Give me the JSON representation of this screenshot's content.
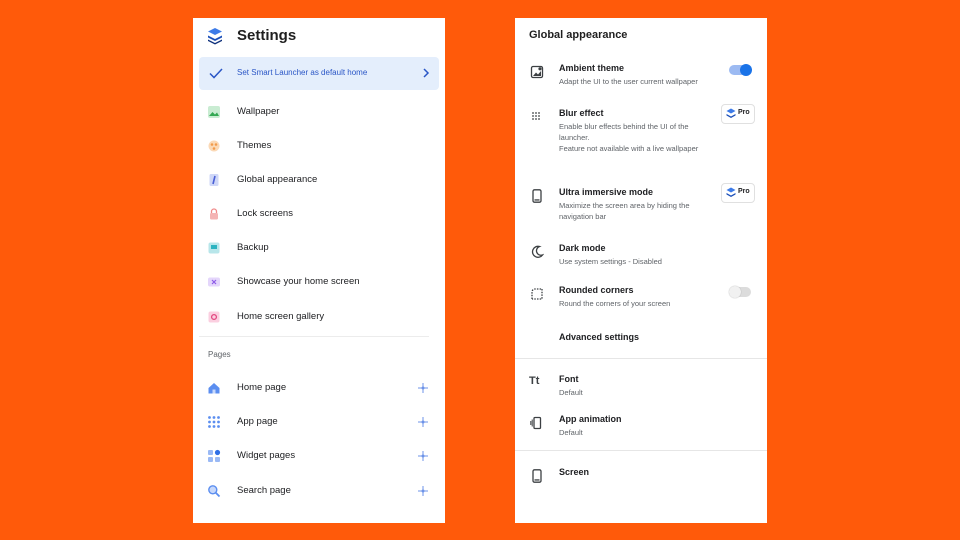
{
  "left": {
    "title": "Settings",
    "banner": "Set Smart Launcher as default home",
    "items": [
      {
        "label": "Wallpaper",
        "icon": "wallpaper-icon"
      },
      {
        "label": "Themes",
        "icon": "themes-icon"
      },
      {
        "label": "Global appearance",
        "icon": "global-appearance-icon"
      },
      {
        "label": "Lock screens",
        "icon": "lock-icon"
      },
      {
        "label": "Backup",
        "icon": "backup-icon"
      },
      {
        "label": "Showcase your home screen",
        "icon": "showcase-icon"
      },
      {
        "label": "Home screen gallery",
        "icon": "gallery-icon"
      }
    ],
    "pages_label": "Pages",
    "pages": [
      {
        "label": "Home page",
        "icon": "home-icon"
      },
      {
        "label": "App page",
        "icon": "app-grid-icon"
      },
      {
        "label": "Widget pages",
        "icon": "widget-icon"
      },
      {
        "label": "Search page",
        "icon": "search-icon"
      }
    ]
  },
  "right": {
    "title": "Global appearance",
    "settings": [
      {
        "title": "Ambient theme",
        "desc": "Adapt the UI to the user current wallpaper",
        "control": "toggle-on",
        "icon": "ambient-theme-icon"
      },
      {
        "title": "Blur effect",
        "desc": "Enable blur effects behind the UI of the launcher.\nFeature not available with a live wallpaper",
        "control": "pro",
        "icon": "blur-icon"
      },
      {
        "title": "Ultra immersive mode",
        "desc": "Maximize the screen area by hiding the navigation bar",
        "control": "pro",
        "icon": "phone-icon"
      },
      {
        "title": "Dark mode",
        "desc": "Use system settings - Disabled",
        "control": "none",
        "icon": "moon-icon"
      },
      {
        "title": "Rounded corners",
        "desc": "Round the corners of your screen",
        "control": "toggle-off",
        "icon": "rounded-corners-icon"
      }
    ],
    "advanced": "Advanced settings",
    "font": {
      "title": "Font",
      "value": "Default"
    },
    "animation": {
      "title": "App animation",
      "value": "Default"
    },
    "screen": "Screen",
    "pro_label": "Pro"
  },
  "colors": {
    "background": "#ff5a0a",
    "accent": "#1a73e8",
    "banner_bg": "#e4eefc"
  }
}
